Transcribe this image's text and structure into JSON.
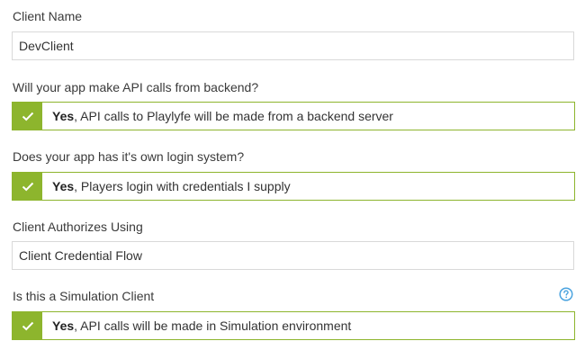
{
  "client_name": {
    "label": "Client Name",
    "value": "DevClient"
  },
  "backend_calls": {
    "label": "Will your app make API calls from backend?",
    "answer": "Yes",
    "description": ", API calls to Playlyfe will be made from a backend server"
  },
  "login_system": {
    "label": "Does your app has it's own login system?",
    "answer": "Yes",
    "description": ", Players login with credentials I supply"
  },
  "authorization": {
    "label": "Client Authorizes Using",
    "value": "Client Credential Flow"
  },
  "simulation": {
    "label": "Is this a Simulation Client",
    "help_icon": "help-icon",
    "answer": "Yes",
    "description": ", API calls will be made in Simulation environment"
  },
  "colors": {
    "accent": "#8db52d",
    "help": "#4aa3df"
  }
}
